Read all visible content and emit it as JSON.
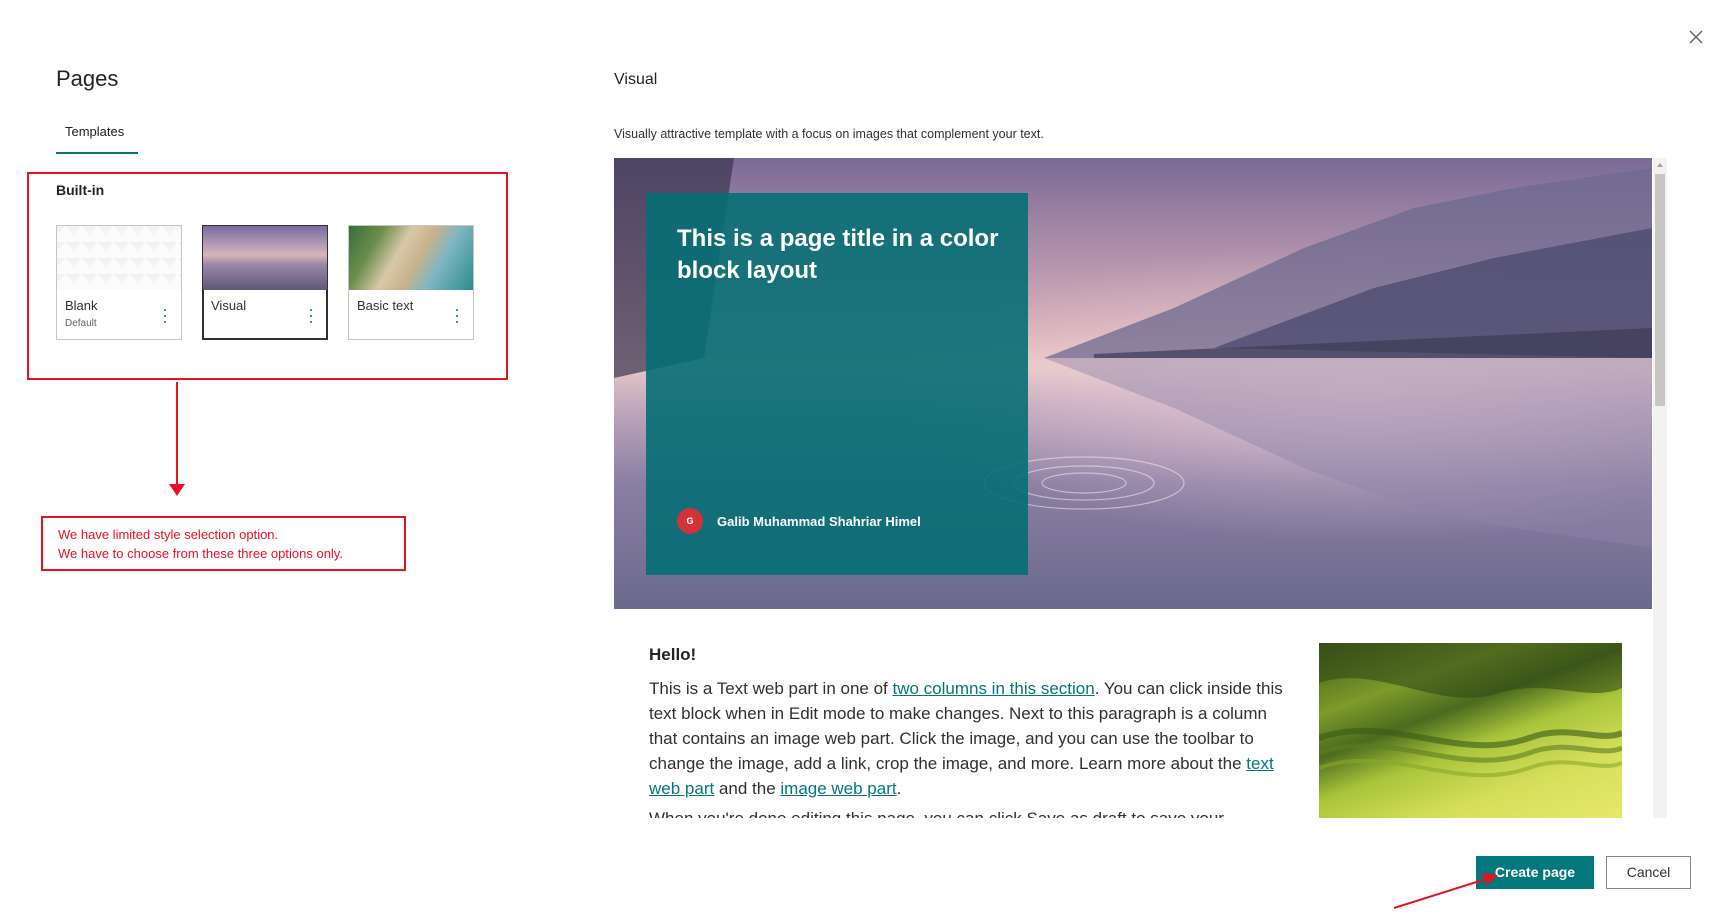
{
  "dialog": {
    "title": "Pages",
    "tab_label": "Templates",
    "section_title": "Built-in",
    "templates": [
      {
        "name": "Blank",
        "sub": "Default"
      },
      {
        "name": "Visual",
        "sub": ""
      },
      {
        "name": "Basic text",
        "sub": ""
      }
    ],
    "selected_template": "Visual"
  },
  "annotation": {
    "line1": "We have limited style selection option.",
    "line2": "We have to choose from these three options only."
  },
  "preview": {
    "title": "Visual",
    "description": "Visually attractive template with a focus on images that complement your text.",
    "hero_title": "This is a page title in a color block layout",
    "author_initial": "G",
    "author_name": "Galib Muhammad Shahriar Himel",
    "hello": "Hello!",
    "body": {
      "t1": "This is a Text web part in one of ",
      "link1": "two columns in this section",
      "t2": ". You can click inside this text block when in Edit mode to make changes. Next to this paragraph is a column that contains an image web part. Click the image, and you can use the toolbar to change the image, add a link, crop the image, and more. Learn more about the ",
      "link2": "text web part",
      "t3": " and the ",
      "link3": "image web part",
      "t4": ".",
      "next": "When you're done editing this page, you can click Save as draft to save your"
    }
  },
  "footer": {
    "create_label": "Create page",
    "cancel_label": "Cancel"
  },
  "colors": {
    "accent": "#03787c",
    "annotation": "#e81123"
  }
}
